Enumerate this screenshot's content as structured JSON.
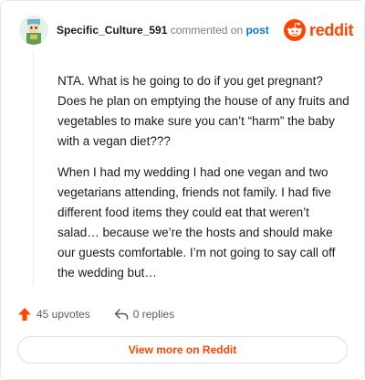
{
  "header": {
    "username": "Specific_Culture_591",
    "commented_on": "commented on",
    "post_link": "post",
    "logo_text": "reddit"
  },
  "comment": {
    "paragraphs": [
      "NTA. What is he going to do if you get pregnant? Does he plan on emptying the house of any fruits and vegetables to make sure you can’t “harm” the baby with a vegan diet???",
      "When I had my wedding I had one vegan and two vegetarians attending, friends not family. I had five different food items they could eat that weren’t salad… because we’re the hosts and should make our guests comfortable. I’m not going to say call off the wedding but…"
    ]
  },
  "actions": {
    "upvotes": "45 upvotes",
    "replies": "0 replies"
  },
  "view_more": "View more on Reddit",
  "colors": {
    "brand": "#ff4500",
    "link": "#0079d3"
  },
  "icons": [
    "avatar-icon",
    "reddit-logo-icon",
    "upvote-arrow-icon",
    "reply-arrow-icon"
  ]
}
